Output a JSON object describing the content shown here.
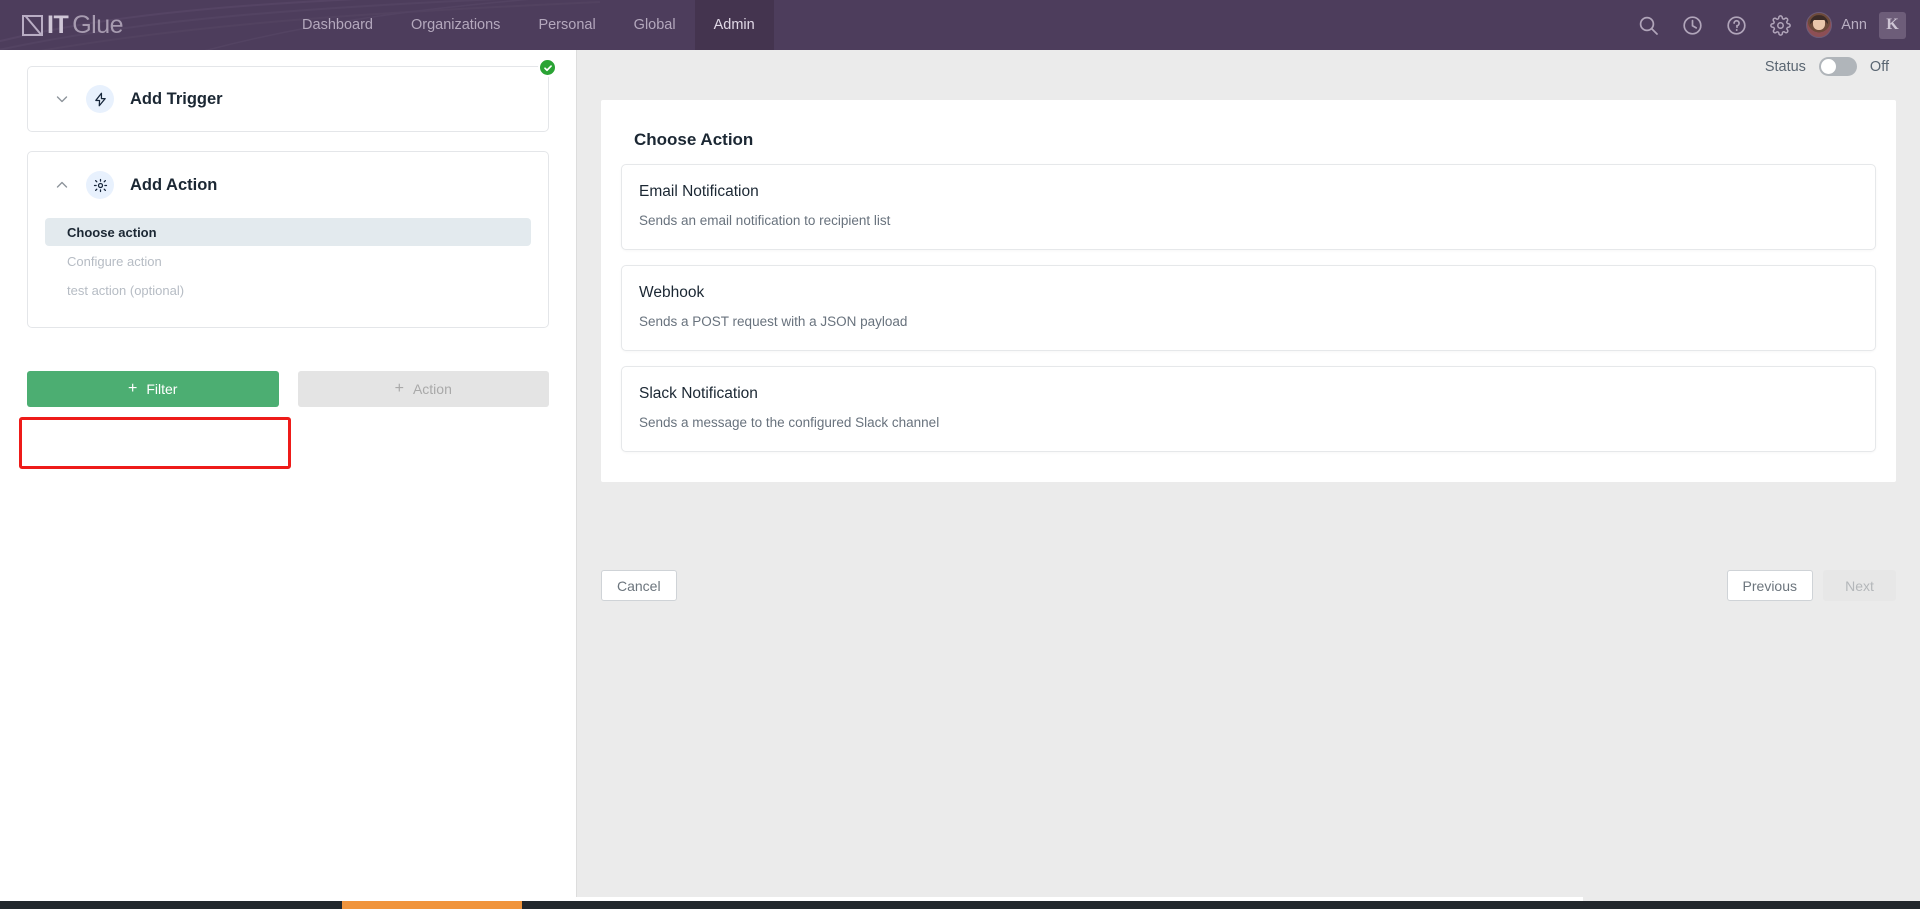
{
  "topbar": {
    "logo": {
      "mark": "itglue-logo-mark",
      "bold": "IT",
      "light": "Glue"
    },
    "nav": [
      {
        "label": "Dashboard",
        "active": false
      },
      {
        "label": "Organizations",
        "active": false
      },
      {
        "label": "Personal",
        "active": false
      },
      {
        "label": "Global",
        "active": false
      },
      {
        "label": "Admin",
        "active": true
      }
    ],
    "icons": [
      "search-icon",
      "history-clock-icon",
      "help-question-icon",
      "gear-icon"
    ],
    "user": {
      "name": "Ann",
      "avatar": "user-avatar"
    },
    "app_badge": "K"
  },
  "left_panel": {
    "trigger_card": {
      "title": "Add Trigger",
      "icon": "lightning-bolt-icon",
      "chevron": "chevron-down-icon",
      "completed": true
    },
    "action_card": {
      "title": "Add Action",
      "icon": "gear-icon",
      "chevron": "chevron-up-icon",
      "steps": [
        {
          "label": "Choose action",
          "active": true
        },
        {
          "label": "Configure action",
          "active": false
        },
        {
          "label": "test action (optional)",
          "active": false
        }
      ]
    },
    "buttons": {
      "filter": {
        "label": "Filter",
        "plus": "+",
        "enabled": true,
        "color": "#4cae72",
        "highlighted": true
      },
      "action": {
        "label": "Action",
        "plus": "+",
        "enabled": false,
        "color": "#e4e4e4"
      }
    }
  },
  "right_panel": {
    "status": {
      "label": "Status",
      "value": "Off",
      "on": false
    },
    "title": "Choose Action",
    "options": [
      {
        "name": "Email Notification",
        "description": "Sends an email notification to recipient list"
      },
      {
        "name": "Webhook",
        "description": "Sends a POST request with a JSON payload"
      },
      {
        "name": "Slack Notification",
        "description": "Sends a message to the configured Slack channel"
      }
    ],
    "footer": {
      "cancel": "Cancel",
      "previous": "Previous",
      "next": "Next",
      "next_disabled": true
    }
  }
}
